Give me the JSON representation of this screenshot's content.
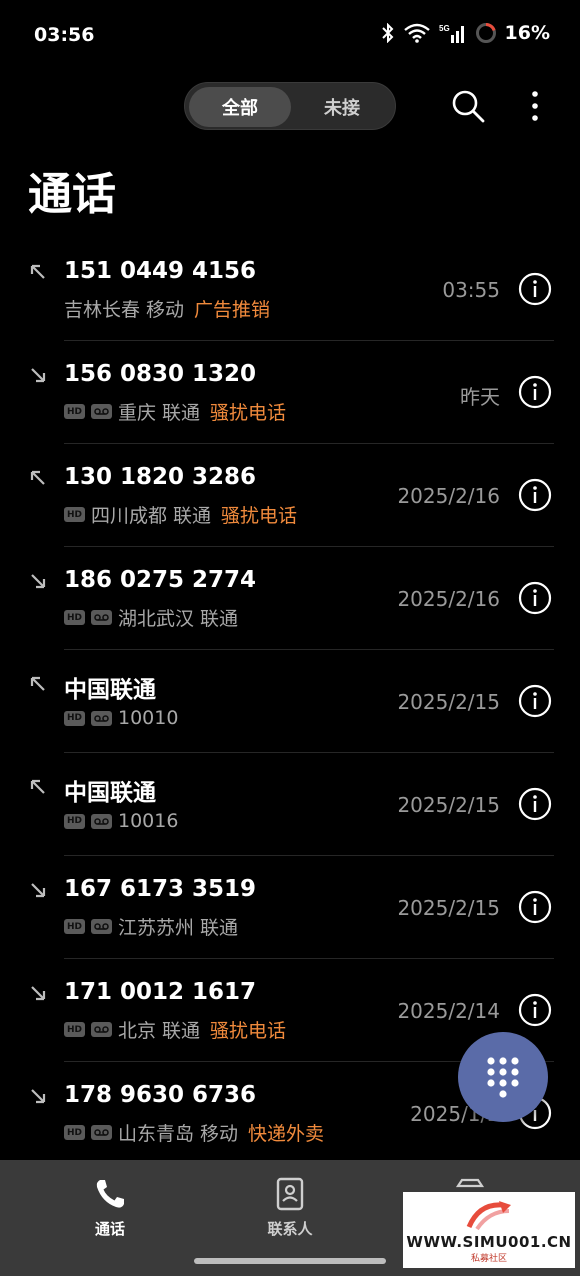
{
  "status_bar": {
    "time": "03:56",
    "network": "5G",
    "battery": "16%"
  },
  "filter": {
    "all_label": "全部",
    "missed_label": "未接"
  },
  "page_title": "通话",
  "calls": [
    {
      "direction": "outgoing",
      "number": "151 0449 4156",
      "hd": false,
      "voicemail": false,
      "location": "吉林长春 移动",
      "tag": "广告推销",
      "time": "03:55"
    },
    {
      "direction": "incoming",
      "number": "156 0830 1320",
      "hd": true,
      "voicemail": true,
      "location": "重庆 联通",
      "tag": "骚扰电话",
      "time": "昨天"
    },
    {
      "direction": "outgoing",
      "number": "130 1820 3286",
      "hd": true,
      "voicemail": false,
      "location": "四川成都 联通",
      "tag": "骚扰电话",
      "time": "2025/2/16"
    },
    {
      "direction": "incoming",
      "number": "186 0275 2774",
      "hd": true,
      "voicemail": true,
      "location": "湖北武汉 联通",
      "tag": "",
      "time": "2025/2/16"
    },
    {
      "direction": "outgoing",
      "number": "中国联通",
      "hd": true,
      "voicemail": true,
      "location": "10010",
      "tag": "",
      "time": "2025/2/15"
    },
    {
      "direction": "outgoing",
      "number": "中国联通",
      "hd": true,
      "voicemail": true,
      "location": "10016",
      "tag": "",
      "time": "2025/2/15"
    },
    {
      "direction": "incoming",
      "number": "167 6173 3519",
      "hd": true,
      "voicemail": true,
      "location": "江苏苏州 联通",
      "tag": "",
      "time": "2025/2/15"
    },
    {
      "direction": "incoming",
      "number": "171 0012 1617",
      "hd": true,
      "voicemail": true,
      "location": "北京 联通",
      "tag": "骚扰电话",
      "time": "2025/2/14"
    },
    {
      "direction": "incoming",
      "number": "178 9630 6736",
      "hd": true,
      "voicemail": true,
      "location": "山东青岛 移动",
      "tag": "快递外卖",
      "time": "2025/1/2"
    }
  ],
  "bottom_nav": {
    "calls_label": "通话",
    "contacts_label": "联系人"
  },
  "watermark": {
    "url": "WWW.SIMU001.CN",
    "sub": "私募社区"
  },
  "colors": {
    "accent_tag": "#f08a3c",
    "fab": "#5a6ba8",
    "background": "#000000"
  }
}
